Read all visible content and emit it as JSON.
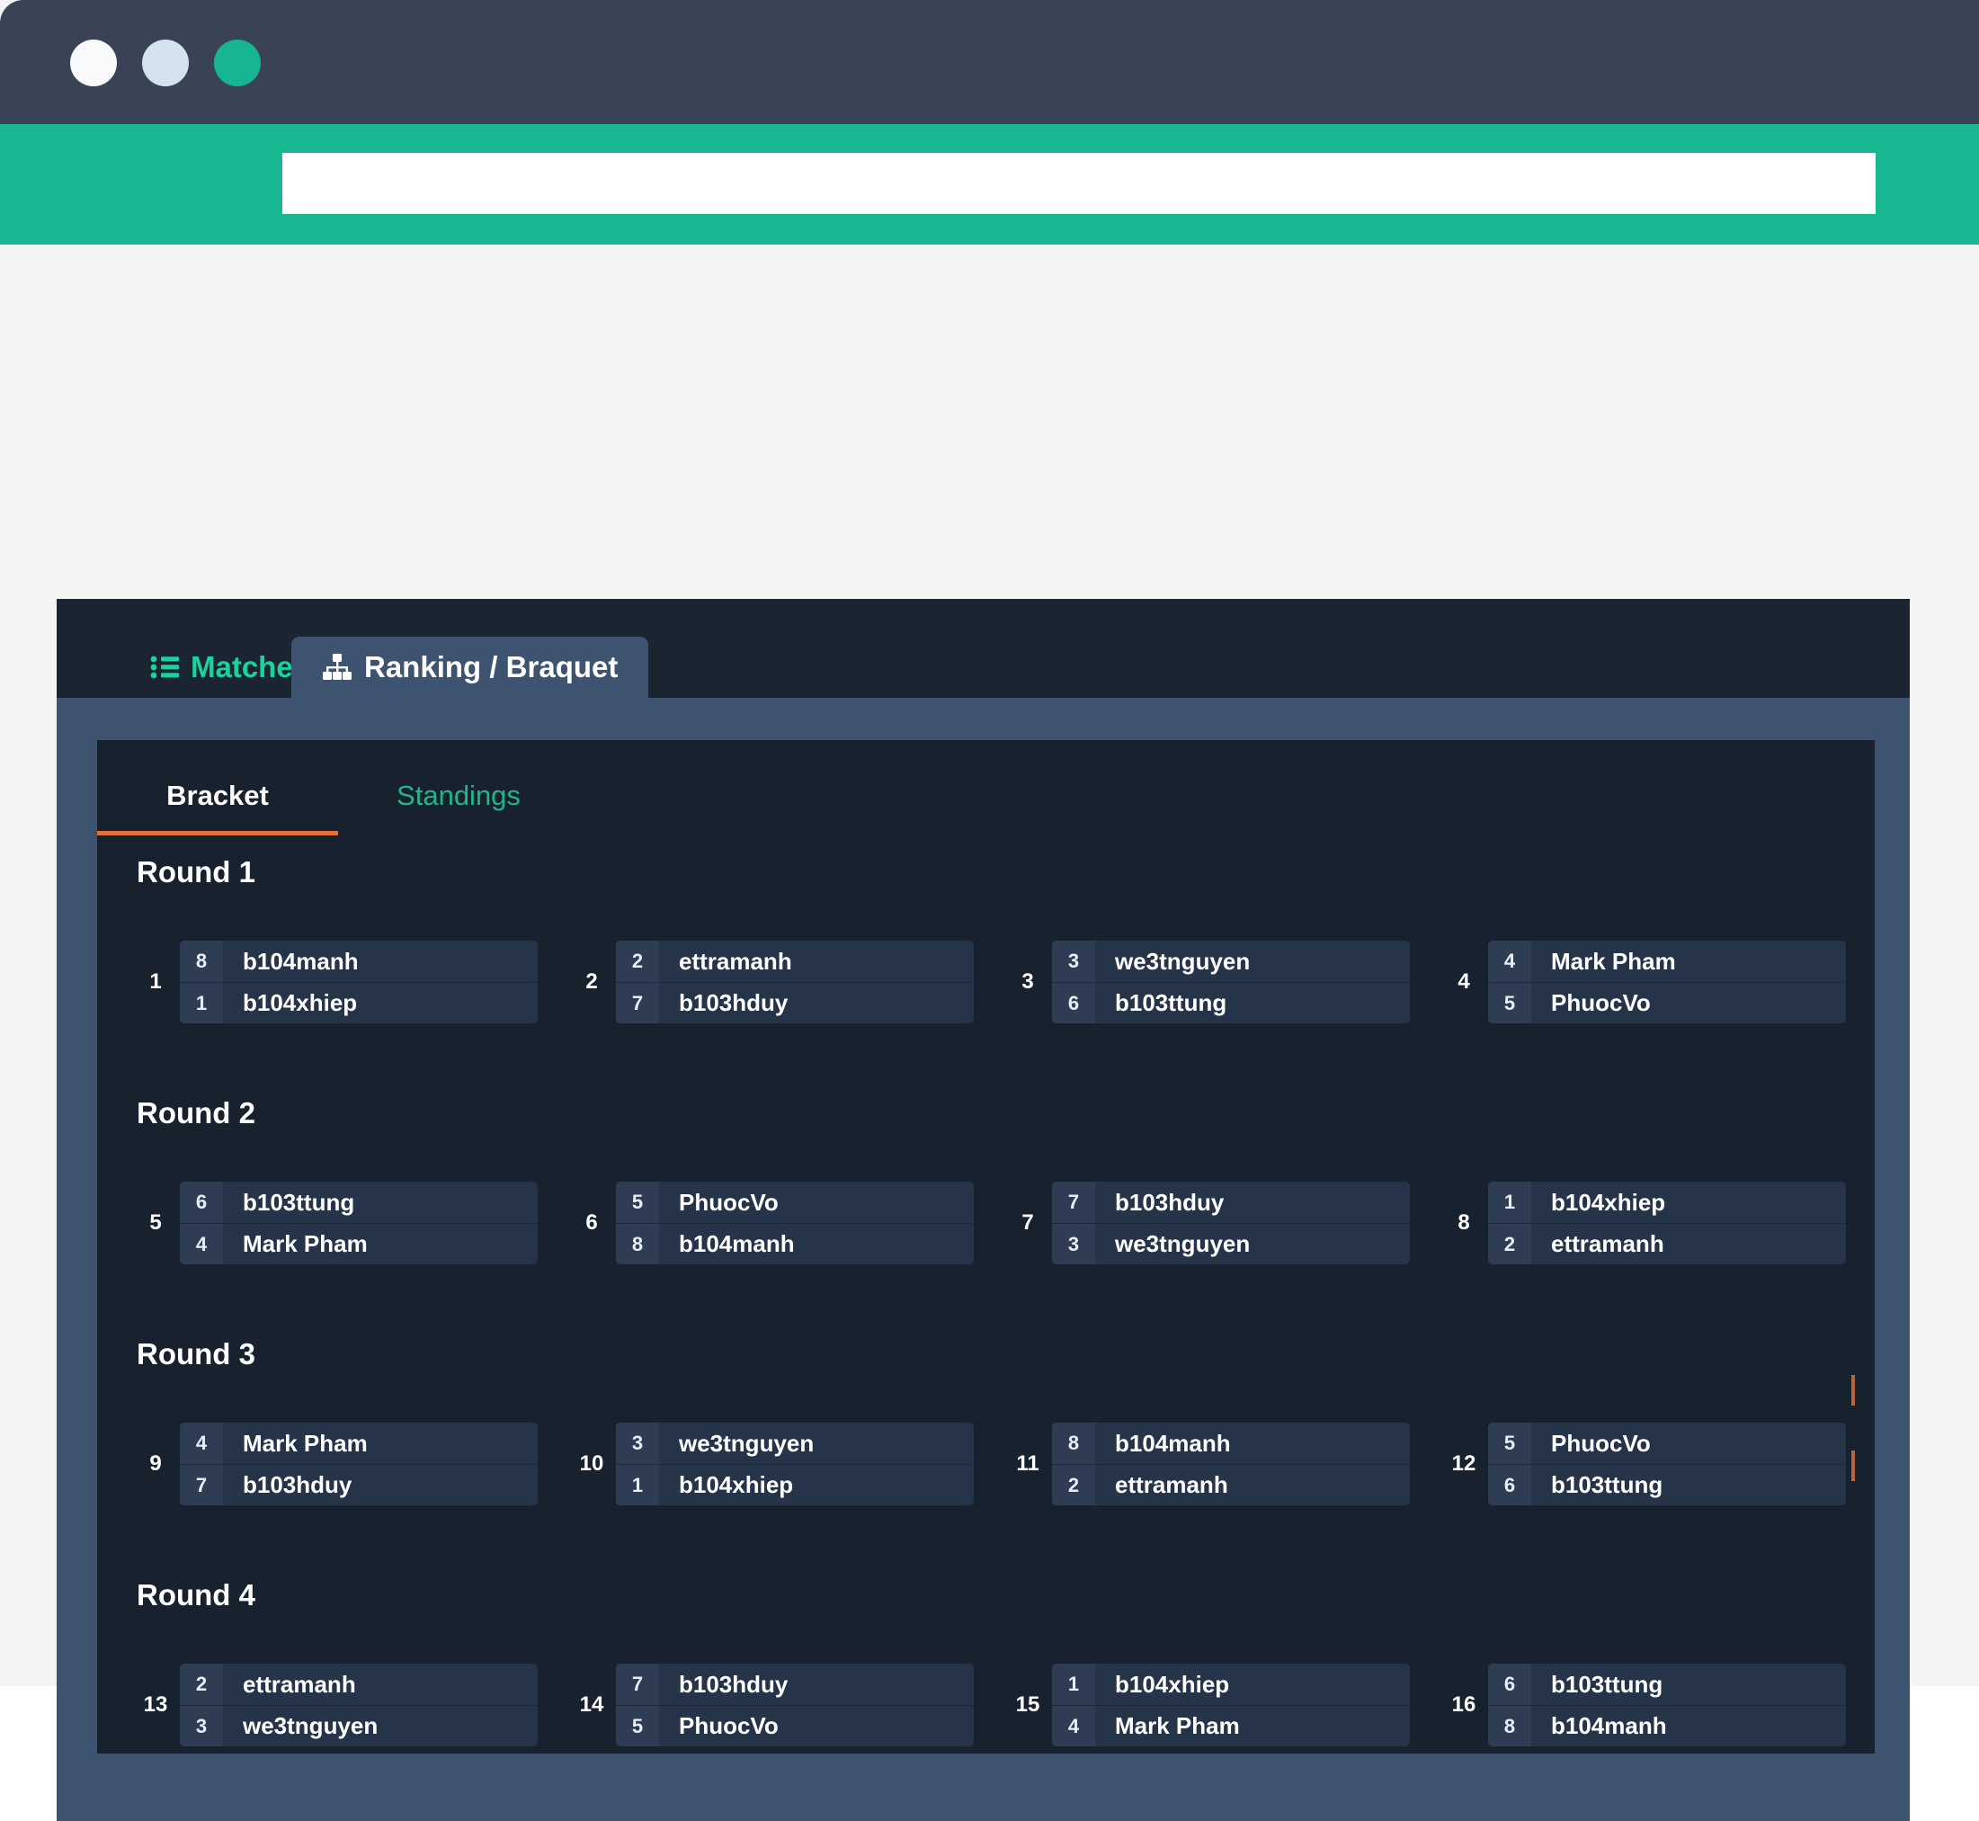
{
  "browser": {
    "dots": [
      "window-dot-white",
      "window-dot-light-blue",
      "window-dot-green"
    ],
    "url_value": "",
    "url_placeholder": ""
  },
  "colors": {
    "accent_teal": "#17b892",
    "accent_green_text": "#18d3a0",
    "accent_orange": "#e2703a",
    "panel_bg": "#18222e",
    "card_bg": "#26344a",
    "seed_bg": "#2e3d54",
    "titlebar_bg": "#3a4255",
    "window_border": "#2f4459"
  },
  "tabs": {
    "items": [
      {
        "label": "Matches",
        "icon": "list-icon",
        "active": false
      },
      {
        "label": "Ranking / Braquet",
        "icon": "sitemap-icon",
        "active": true
      }
    ]
  },
  "inner_tabs": {
    "items": [
      {
        "label": "Bracket",
        "active": true
      },
      {
        "label": "Standings",
        "active": false
      }
    ]
  },
  "bracket": {
    "rounds": [
      {
        "title": "Round 1",
        "matches": [
          {
            "index": "1",
            "competitors": [
              {
                "seed": "8",
                "name": "b104manh"
              },
              {
                "seed": "1",
                "name": "b104xhiep"
              }
            ]
          },
          {
            "index": "2",
            "competitors": [
              {
                "seed": "2",
                "name": "ettramanh"
              },
              {
                "seed": "7",
                "name": "b103hduy"
              }
            ]
          },
          {
            "index": "3",
            "competitors": [
              {
                "seed": "3",
                "name": "we3tnguyen"
              },
              {
                "seed": "6",
                "name": "b103ttung"
              }
            ]
          },
          {
            "index": "4",
            "competitors": [
              {
                "seed": "4",
                "name": "Mark Pham"
              },
              {
                "seed": "5",
                "name": "PhuocVo"
              }
            ]
          }
        ]
      },
      {
        "title": "Round 2",
        "matches": [
          {
            "index": "5",
            "competitors": [
              {
                "seed": "6",
                "name": "b103ttung"
              },
              {
                "seed": "4",
                "name": "Mark Pham"
              }
            ]
          },
          {
            "index": "6",
            "competitors": [
              {
                "seed": "5",
                "name": "PhuocVo"
              },
              {
                "seed": "8",
                "name": "b104manh"
              }
            ]
          },
          {
            "index": "7",
            "competitors": [
              {
                "seed": "7",
                "name": "b103hduy"
              },
              {
                "seed": "3",
                "name": "we3tnguyen"
              }
            ]
          },
          {
            "index": "8",
            "competitors": [
              {
                "seed": "1",
                "name": "b104xhiep"
              },
              {
                "seed": "2",
                "name": "ettramanh"
              }
            ]
          }
        ]
      },
      {
        "title": "Round 3",
        "matches": [
          {
            "index": "9",
            "competitors": [
              {
                "seed": "4",
                "name": "Mark Pham"
              },
              {
                "seed": "7",
                "name": "b103hduy"
              }
            ]
          },
          {
            "index": "10",
            "competitors": [
              {
                "seed": "3",
                "name": "we3tnguyen"
              },
              {
                "seed": "1",
                "name": "b104xhiep"
              }
            ]
          },
          {
            "index": "11",
            "competitors": [
              {
                "seed": "8",
                "name": "b104manh"
              },
              {
                "seed": "2",
                "name": "ettramanh"
              }
            ]
          },
          {
            "index": "12",
            "competitors": [
              {
                "seed": "5",
                "name": "PhuocVo"
              },
              {
                "seed": "6",
                "name": "b103ttung"
              }
            ]
          }
        ]
      },
      {
        "title": "Round 4",
        "matches": [
          {
            "index": "13",
            "competitors": [
              {
                "seed": "2",
                "name": "ettramanh"
              },
              {
                "seed": "3",
                "name": "we3tnguyen"
              }
            ]
          },
          {
            "index": "14",
            "competitors": [
              {
                "seed": "7",
                "name": "b103hduy"
              },
              {
                "seed": "5",
                "name": "PhuocVo"
              }
            ]
          },
          {
            "index": "15",
            "competitors": [
              {
                "seed": "1",
                "name": "b104xhiep"
              },
              {
                "seed": "4",
                "name": "Mark Pham"
              }
            ]
          },
          {
            "index": "16",
            "competitors": [
              {
                "seed": "6",
                "name": "b103ttung"
              },
              {
                "seed": "8",
                "name": "b104manh"
              }
            ]
          }
        ]
      }
    ]
  }
}
